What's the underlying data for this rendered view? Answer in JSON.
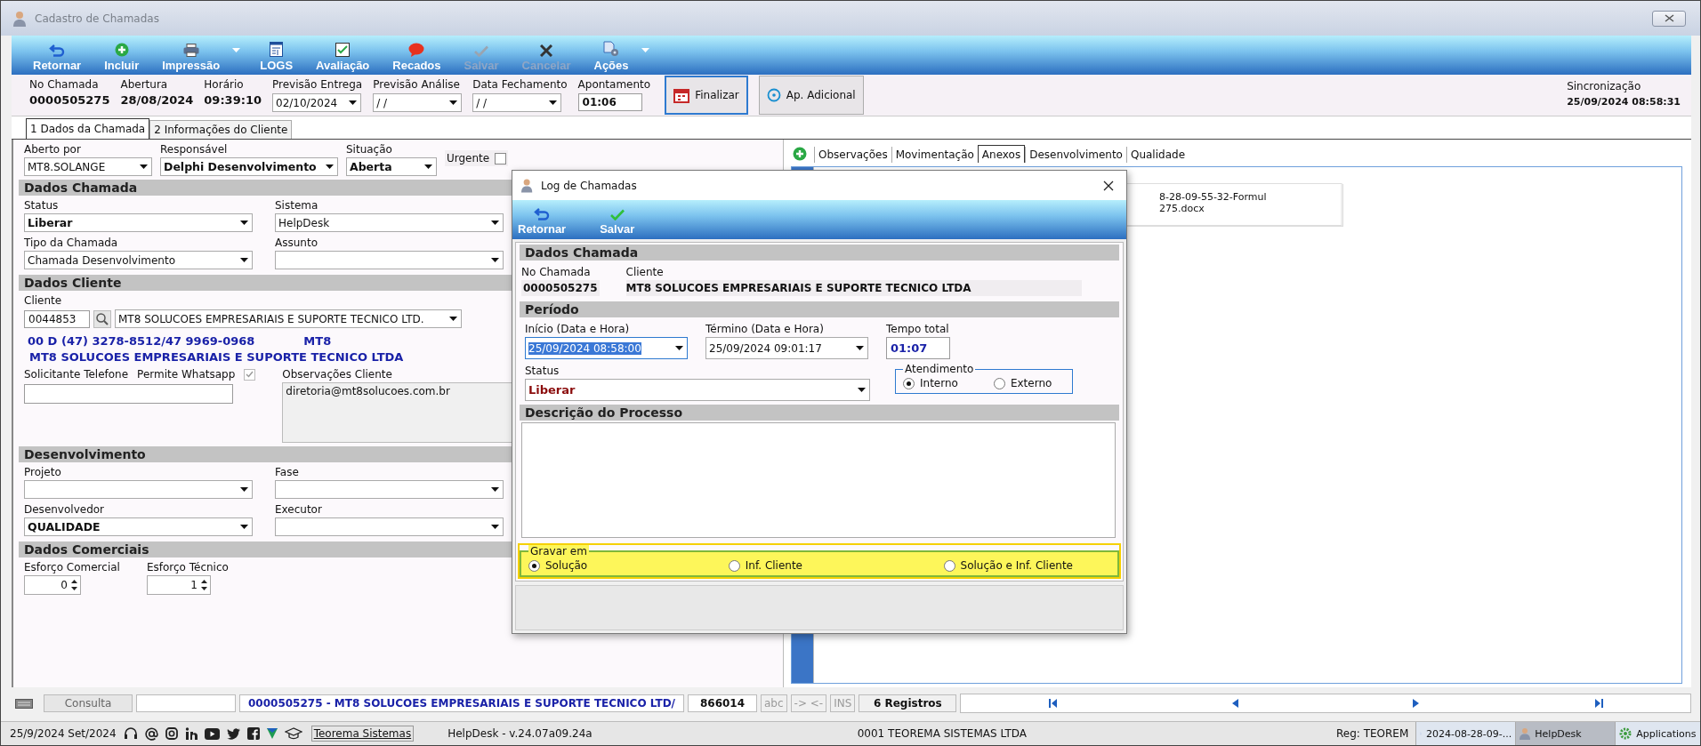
{
  "window": {
    "title": "Cadastro de Chamadas"
  },
  "toolbar": [
    {
      "label": "Retornar",
      "disabled": false,
      "dropdown": false
    },
    {
      "label": "Incluir",
      "disabled": false,
      "dropdown": false
    },
    {
      "label": "Impressão",
      "disabled": false,
      "dropdown": true
    },
    {
      "label": "LOGS",
      "disabled": false,
      "dropdown": false
    },
    {
      "label": "Avaliação",
      "disabled": false,
      "dropdown": false
    },
    {
      "label": "Recados",
      "disabled": false,
      "dropdown": false
    },
    {
      "label": "Salvar",
      "disabled": true,
      "dropdown": false
    },
    {
      "label": "Cancelar",
      "disabled": true,
      "dropdown": false
    },
    {
      "label": "Ações",
      "disabled": false,
      "dropdown": true
    }
  ],
  "header": {
    "fields": [
      {
        "kind": "text",
        "label": "No Chamada",
        "value": "0000505275"
      },
      {
        "kind": "text",
        "label": "Abertura",
        "value": "28/08/2024"
      },
      {
        "kind": "text",
        "label": "Horário",
        "value": "09:39:10"
      },
      {
        "kind": "date",
        "label": "Previsão Entrega",
        "value": "02/10/2024"
      },
      {
        "kind": "date",
        "label": "Previsão Análise",
        "value": " /  /"
      },
      {
        "kind": "date",
        "label": "Data Fechamento",
        "value": " /  /"
      },
      {
        "kind": "input",
        "label": "Apontamento",
        "value": "01:06"
      }
    ],
    "buttons": [
      {
        "label": "Finalizar",
        "focused": true
      },
      {
        "label": "Ap. Adicional",
        "focused": false
      }
    ],
    "sync": {
      "label": "Sincronização",
      "value": "25/09/2024 08:58:31"
    }
  },
  "tabs": [
    {
      "label": "1 Dados da Chamada",
      "selected": true
    },
    {
      "label": "2 Informações do Cliente",
      "selected": false
    }
  ],
  "form": {
    "top": [
      {
        "label": "Aberto por",
        "value": "MT8.SOLANGE",
        "bold": false
      },
      {
        "label": "Responsável",
        "value": "Delphi Desenvolvimento",
        "bold": true
      },
      {
        "label": "Situação",
        "value": "Aberta",
        "bold": true
      }
    ],
    "urgente": {
      "label": "Urgente",
      "checked": false
    },
    "dados_chamada": {
      "title": "Dados Chamada",
      "fields": [
        {
          "label": "Status",
          "value": "Liberar",
          "bold": true
        },
        {
          "label": "Sistema",
          "value": "HelpDesk",
          "bold": false
        },
        {
          "label": "Tipo da Chamada",
          "value": "Chamada Desenvolvimento",
          "bold": false
        },
        {
          "label": "Assunto"
        }
      ]
    },
    "dados_cliente": {
      "title": "Dados Cliente",
      "label": "Cliente",
      "code": "0044853",
      "name": "MT8 SOLUCOES EMPRESARIAIS E SUPORTE TECNICO LTD.",
      "phone": "00  D  (47) 3278-8512/47 9969-0968",
      "short_name": "MT8",
      "full_name": "MT8 SOLUCOES EMPRESARIAIS E SUPORTE TECNICO LTDA",
      "solicitante_label": "Solicitante Telefone",
      "whatsapp": {
        "label": "Permite Whatsapp",
        "checked": true
      },
      "obs_label": "Observações Cliente",
      "obs_value": "diretoria@mt8solucoes.com.br"
    },
    "desenvolvimento": {
      "title": "Desenvolvimento",
      "fields": [
        {
          "label": "Projeto"
        },
        {
          "label": "Fase"
        },
        {
          "label": "Desenvolvedor",
          "value": "QUALIDADE",
          "bold": true
        },
        {
          "label": "Executor"
        }
      ]
    },
    "dados_comerciais": {
      "title": "Dados Comerciais",
      "spinners": [
        {
          "label": "Esforço Comercial",
          "value": "0"
        },
        {
          "label": "Esforço Técnico",
          "value": "1"
        }
      ]
    }
  },
  "right_panel": {
    "tabs": [
      {
        "label": "Observações",
        "selected": false
      },
      {
        "label": "Movimentação",
        "selected": false
      },
      {
        "label": "Anexos",
        "selected": true
      },
      {
        "label": "Desenvolvimento",
        "selected": false
      },
      {
        "label": "Qualidade",
        "selected": false
      }
    ],
    "file": [
      "8-28-09-55-32-Formul",
      "275.docx"
    ]
  },
  "dialog": {
    "title": "Log de Chamadas",
    "toolbar": [
      {
        "label": "Retornar"
      },
      {
        "label": "Salvar"
      }
    ],
    "dados": {
      "title": "Dados Chamada",
      "no_label": "No Chamada",
      "no_value": "0000505275",
      "cliente_label": "Cliente",
      "cliente_value": "MT8 SOLUCOES EMPRESARIAIS E SUPORTE TECNICO LTDA"
    },
    "periodo": {
      "title": "Período",
      "inicio_label": "Início (Data e Hora)",
      "inicio_value": "25/09/2024 08:58:00",
      "termino_label": "Término (Data e Hora)",
      "termino_value": "25/09/2024 09:01:17",
      "total_label": "Tempo total",
      "total_value": "01:07",
      "status_label": "Status",
      "status_value": "Liberar",
      "atendimento": {
        "title": "Atendimento",
        "options": [
          {
            "label": "Interno",
            "selected": true
          },
          {
            "label": "Externo",
            "selected": false
          }
        ]
      }
    },
    "descricao": {
      "title": "Descrição do Processo"
    },
    "gravar": {
      "title": "Gravar em",
      "options": [
        {
          "label": "Solução",
          "selected": true
        },
        {
          "label": "Inf. Cliente",
          "selected": false
        },
        {
          "label": "Solução e Inf. Cliente",
          "selected": false
        }
      ]
    }
  },
  "status_bar": {
    "mode": "Consulta",
    "record": "0000505275 - MT8 SOLUCOES EMPRESARIAIS E SUPORTE TECNICO LTD/",
    "code": "866014",
    "abc": "abc",
    "arrows": "-> <-",
    "ins": "INS",
    "count": "6 Registros"
  },
  "taskbar": {
    "date": "25/9/2024 Set/2024",
    "link": "Teorema Sistemas",
    "version": "HelpDesk - v.24.07a09.24a",
    "company": "0001 TEOREMA SISTEMAS LTDA",
    "reg": "Reg: TEOREM",
    "apps": [
      {
        "label": "2024-08-28-09-...",
        "selected": false
      },
      {
        "label": "HelpDesk",
        "selected": true
      },
      {
        "label": "Applications",
        "selected": false
      }
    ]
  }
}
